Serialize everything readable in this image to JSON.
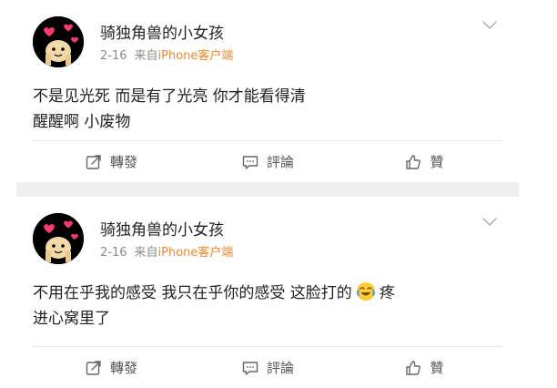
{
  "posts": [
    {
      "username": "骑独角兽的小女孩",
      "date": "2-16",
      "source_prefix": "来自",
      "source_name": "iPhone客户端",
      "content_line1": "不是见光死 而是有了光亮 你才能看得清",
      "content_line2": "醒醒啊 小废物",
      "actions": {
        "repost": "轉發",
        "comment": "評論",
        "like": "贊"
      }
    },
    {
      "username": "骑独角兽的小女孩",
      "date": "2-16",
      "source_prefix": "来自",
      "source_name": "iPhone客户端",
      "content_line1_before_emoji": "不用在乎我的感受 我只在乎你的感受 这脸打的",
      "content_line1_after_emoji": "疼",
      "content_line2": "进心窝里了",
      "actions": {
        "repost": "轉發",
        "comment": "評論",
        "like": "贊"
      }
    }
  ],
  "icons": {
    "avatar": "avatar-image",
    "more": "chevron-down-icon",
    "repost": "repost-icon",
    "comment": "comment-icon",
    "like": "thumbs-up-icon",
    "emoji": "laugh-cry-emoji-icon"
  },
  "colors": {
    "source_orange": "#ef8a28",
    "meta_gray": "#8a8a8a",
    "separator": "#efefef"
  }
}
